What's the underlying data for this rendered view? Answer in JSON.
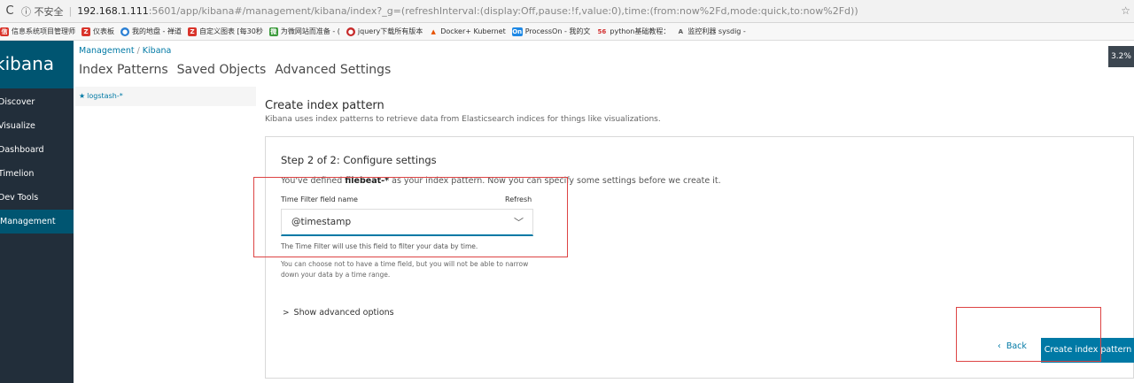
{
  "browser": {
    "security": "ⓘ 不安全",
    "url_host": "192.168.1.111",
    "url_path": ":5601/app/kibana#/management/kibana/index?_g=(refreshInterval:(display:Off,pause:!f,value:0),time:(from:now%2Fd,mode:quick,to:now%2Fd))",
    "bookmarks": [
      {
        "label": "信息系统项目管理师",
        "color": "#d9342b",
        "icon": "building-icon"
      },
      {
        "label": "仪表板",
        "color": "#d9342b",
        "icon": "z-icon"
      },
      {
        "label": "我的地盘 - 禅道",
        "color": "#2a7fd4",
        "icon": "globe-icon"
      },
      {
        "label": "自定义图表 [每30秒",
        "color": "#d9342b",
        "icon": "z-icon"
      },
      {
        "label": "为微网站而准备 - (",
        "color": "#3a9a3a",
        "icon": "green-icon"
      },
      {
        "label": "jquery下载所有版本",
        "color": "#c62828",
        "icon": "circle-icon"
      },
      {
        "label": "Docker+ Kubernet",
        "color": "#e65100",
        "icon": "flame-icon"
      },
      {
        "label": "ProcessOn - 我的文",
        "color": "#1e88e5",
        "icon": "on-icon"
      },
      {
        "label": "python基础教程：",
        "color": "#d32f2f",
        "icon": "56-icon"
      },
      {
        "label": "监控利器 sysdig -",
        "color": "#555555",
        "icon": "ab-icon"
      }
    ],
    "fav_text": [
      "信",
      "Z",
      "●",
      "Z",
      "微",
      "●",
      "▲",
      "On",
      "56",
      "A"
    ]
  },
  "sidebar": {
    "logo": "kibana",
    "items": [
      {
        "label": "Discover"
      },
      {
        "label": "Visualize"
      },
      {
        "label": "Dashboard"
      },
      {
        "label": "Timelion"
      },
      {
        "label": "Dev Tools"
      },
      {
        "label": "Management"
      }
    ],
    "active": "Management"
  },
  "header": {
    "crumb1": "Management",
    "crumb2": "Kibana",
    "tabs": [
      {
        "label": "Index Patterns"
      },
      {
        "label": "Saved Objects"
      },
      {
        "label": "Advanced Settings"
      }
    ]
  },
  "patterns": {
    "items": [
      {
        "label": "logstash-*"
      }
    ]
  },
  "main": {
    "title": "Create index pattern",
    "subtitle": "Kibana uses index patterns to retrieve data from Elasticsearch indices for things like visualizations."
  },
  "step": {
    "title": "Step 2 of 2: Configure settings",
    "defined_prefix": "You've defined ",
    "defined_pattern": "filebeat-*",
    "defined_suffix": " as your index pattern. Now you can specify some settings before we create it.",
    "field_label": "Time Filter field name",
    "refresh": "Refresh",
    "selected": "@timestamp",
    "help1": "The Time Filter will use this field to filter your data by time.",
    "help2": "You can choose not to have a time field, but you will not be able to narrow down your data by a time range.",
    "advanced": "Show advanced options",
    "back": "Back",
    "create": "Create index pattern"
  },
  "overlay": {
    "cpu": "3.2%"
  },
  "colors": {
    "accent": "#0079a5",
    "sidebar_bg": "#222e3a",
    "sidebar_active": "#005571",
    "annotation": "#dd4444"
  }
}
